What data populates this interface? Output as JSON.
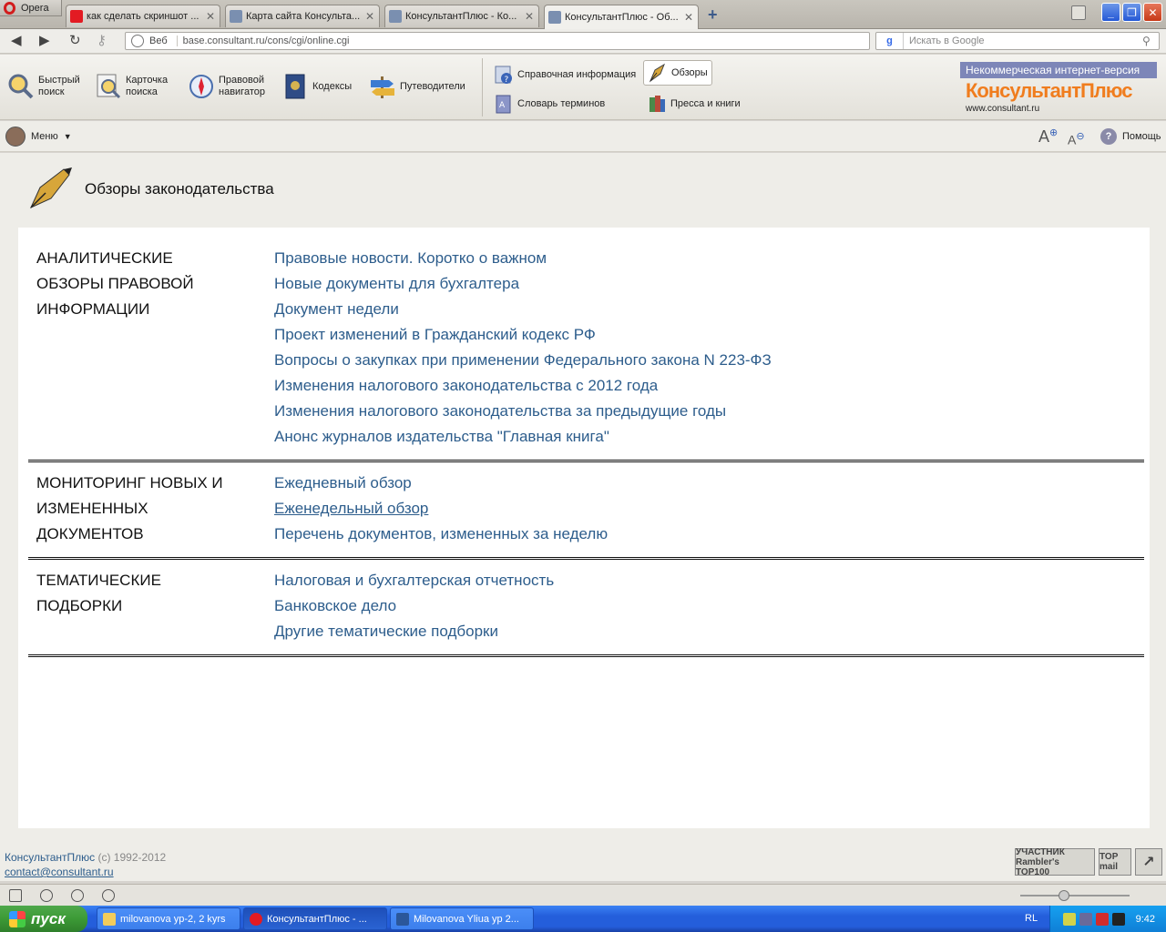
{
  "browser": {
    "opera_label": "Opera",
    "tabs": [
      {
        "title": "как сделать скриншот ...",
        "fav": "#e31b23"
      },
      {
        "title": "Карта сайта Консульта...",
        "fav": "#7a8fb0"
      },
      {
        "title": "КонсультантПлюс - Ко...",
        "fav": "#7a8fb0"
      },
      {
        "title": "КонсультантПлюс - Об...",
        "fav": "#7a8fb0"
      }
    ],
    "address": {
      "label": "Веб",
      "url": "base.consultant.ru/cons/cgi/online.cgi"
    },
    "search": {
      "engine": "g",
      "placeholder": "Искать в Google"
    }
  },
  "toolbar": {
    "main_buttons": [
      "Быстрый\nпоиск",
      "Карточка\nпоиска",
      "Правовой\nнавигатор",
      "Кодексы",
      "Путеводители"
    ],
    "secondary": {
      "reference": "Справочная информация",
      "reviews": "Обзоры",
      "glossary": "Словарь терминов",
      "press": "Пресса и книги"
    },
    "logo": {
      "strip": "Некоммерческая интернет-версия",
      "brand": "КонсультантПлюс",
      "site": "www.consultant.ru"
    }
  },
  "menubar": {
    "menu": "Меню",
    "help": "Помощь"
  },
  "page": {
    "title": "Обзоры законодательства",
    "sections": [
      {
        "title": [
          "АНАЛИТИЧЕСКИЕ",
          "ОБЗОРЫ ПРАВОВОЙ",
          "ИНФОРМАЦИИ"
        ],
        "links": [
          "Правовые новости. Коротко о важном",
          "Новые документы для бухгалтера",
          "Документ недели",
          "Проект изменений в Гражданский кодекс РФ",
          "Вопросы о закупках при применении Федерального закона N 223-ФЗ",
          "Изменения налогового законодательства с 2012 года",
          "Изменения налогового законодательства за предыдущие годы",
          "Анонс журналов издательства \"Главная книга\""
        ]
      },
      {
        "title": [
          "МОНИТОРИНГ НОВЫХ И",
          "ИЗМЕНЕННЫХ",
          "ДОКУМЕНТОВ"
        ],
        "links": [
          "Ежедневный обзор",
          "Еженедельный обзор",
          "Перечень документов, измененных за неделю"
        ]
      },
      {
        "title": [
          "ТЕМАТИЧЕСКИЕ",
          "ПОДБОРКИ"
        ],
        "links": [
          "Налоговая и бухгалтерская отчетность",
          "Банковское дело",
          "Другие тематические подборки"
        ]
      }
    ],
    "footer": {
      "brand": "КонсультантПлюс",
      "copyright": "(c) 1992-2012",
      "email": "contact@consultant.ru"
    },
    "counters": {
      "rambler": "УЧАСТНИК Rambler's TOP100",
      "mail": "TOP mail"
    }
  },
  "taskbar": {
    "start": "пуск",
    "tasks": [
      "milovanova yp-2, 2 kyrs",
      "КонсультантПлюс - ...",
      "Milovanova Yliua yp 2..."
    ],
    "lang": "RL",
    "clock": "9:42"
  },
  "colors": {
    "link": "#2d5d8c",
    "brand_orange": "#f07d1e",
    "logo_strip": "#7d86b8"
  }
}
